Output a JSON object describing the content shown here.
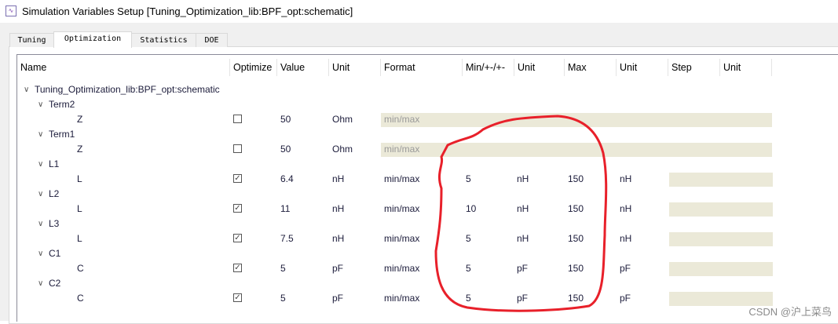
{
  "window": {
    "title": "Simulation Variables Setup [Tuning_Optimization_lib:BPF_opt:schematic]",
    "icon": "waveform-app-icon"
  },
  "tabs": [
    {
      "label": "Tuning"
    },
    {
      "label": "Optimization",
      "active": true
    },
    {
      "label": "Statistics"
    },
    {
      "label": "DOE"
    }
  ],
  "columns": [
    "Name",
    "Optimize",
    "Value",
    "Unit",
    "Format",
    "Min/+-/+-",
    "Unit",
    "Max",
    "Unit",
    "Step",
    "Unit"
  ],
  "rows": [
    {
      "name": "Tuning_Optimization_lib:BPF_opt:schematic",
      "level": 0,
      "expand": true
    },
    {
      "name": "Term2",
      "level": 1,
      "expand": true
    },
    {
      "name": "Z",
      "level": 2,
      "optimize": false,
      "value": "50",
      "unit": "Ohm",
      "format": "min/max",
      "disabled": true
    },
    {
      "name": "Term1",
      "level": 1,
      "expand": true
    },
    {
      "name": "Z",
      "level": 2,
      "optimize": false,
      "value": "50",
      "unit": "Ohm",
      "format": "min/max",
      "disabled": true
    },
    {
      "name": "L1",
      "level": 1,
      "expand": true
    },
    {
      "name": "L",
      "level": 2,
      "optimize": true,
      "value": "6.4",
      "unit": "nH",
      "format": "min/max",
      "min": "5",
      "minUnit": "nH",
      "max": "150",
      "maxUnit": "nH"
    },
    {
      "name": "L2",
      "level": 1,
      "expand": true
    },
    {
      "name": "L",
      "level": 2,
      "optimize": true,
      "value": "11",
      "unit": "nH",
      "format": "min/max",
      "min": "10",
      "minUnit": "nH",
      "max": "150",
      "maxUnit": "nH"
    },
    {
      "name": "L3",
      "level": 1,
      "expand": true
    },
    {
      "name": "L",
      "level": 2,
      "optimize": true,
      "value": "7.5",
      "unit": "nH",
      "format": "min/max",
      "min": "5",
      "minUnit": "nH",
      "max": "150",
      "maxUnit": "nH"
    },
    {
      "name": "C1",
      "level": 1,
      "expand": true
    },
    {
      "name": "C",
      "level": 2,
      "optimize": true,
      "value": "5",
      "unit": "pF",
      "format": "min/max",
      "min": "5",
      "minUnit": "pF",
      "max": "150",
      "maxUnit": "pF"
    },
    {
      "name": "C2",
      "level": 1,
      "expand": true
    },
    {
      "name": "C",
      "level": 2,
      "optimize": true,
      "value": "5",
      "unit": "pF",
      "format": "min/max",
      "min": "5",
      "minUnit": "pF",
      "max": "150",
      "maxUnit": "pF"
    }
  ],
  "watermark": "CSDN @沪上菜鸟",
  "colors": {
    "disabled_bg": "#ebe9d8",
    "annotation": "#e8202a"
  }
}
